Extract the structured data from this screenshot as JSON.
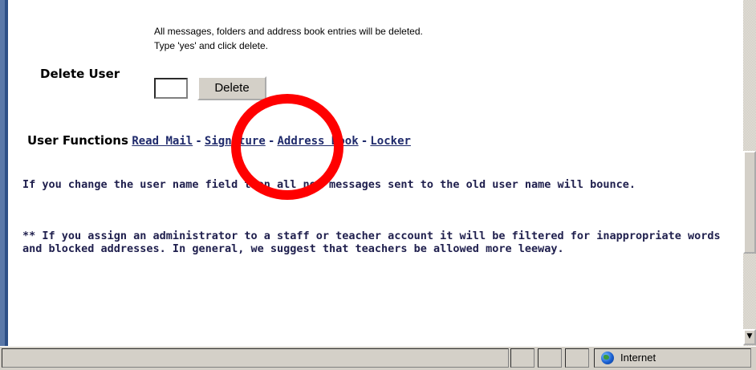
{
  "warning": {
    "line1": "All messages, folders and address book entries will be deleted.",
    "line2": "Type 'yes' and click delete."
  },
  "delete_section": {
    "label": "Delete User",
    "input_value": "",
    "button_label": "Delete"
  },
  "user_functions": {
    "title": "User Functions",
    "separator": "-",
    "links": [
      "Read Mail",
      "Signature",
      "Address Book",
      "Locker"
    ]
  },
  "notes": {
    "note1": "If you change the user name field then all new messages sent to the old user name will bounce.",
    "note2": "** If you assign an administrator to a staff or teacher account it will be filtered for inappropriate words and blocked addresses. In general, we suggest that teachers be allowed more leeway."
  },
  "statusbar": {
    "zone_label": "Internet",
    "zone_icon": "globe-icon"
  },
  "colors": {
    "annotation": "#ff0000",
    "link": "#1f2a6b",
    "left_bar": "#2d4f86"
  }
}
